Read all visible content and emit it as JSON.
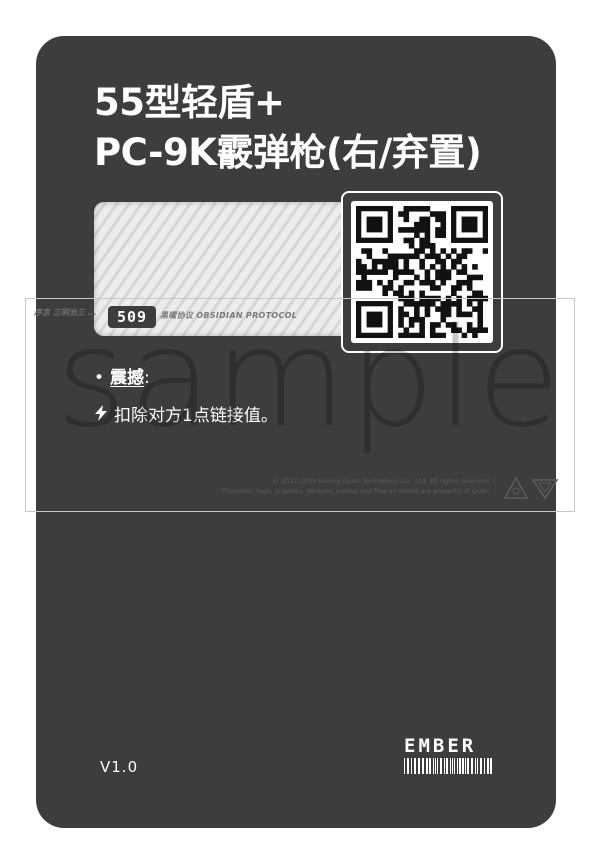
{
  "card": {
    "title_line1": "55型轻盾+",
    "title_line2": "PC-9K霰弹枪(右/弃置)",
    "card_id": "509",
    "art_caption": "黑曜协议 OBSIDIAN PROTOCOL",
    "effect_keyword": "震撼",
    "effect_colon": ":",
    "effect_text": "扣除对方1点链接值。",
    "copyright_line1": "© 2017-2018 Beijing Quan Technology Co., Ltd. All rights reserved",
    "copyright_line2": "Character, logo, graphics, designs, names and fine on model are property of Quan",
    "version": "V1.0",
    "brand_logo": "EMBER"
  },
  "watermark": {
    "text": "sample",
    "strip_text": "序言 三明治三 ..."
  },
  "colors": {
    "card_bg": "#3d3d3d",
    "text": "#ffffff",
    "watermark": "#000000"
  },
  "icons": {
    "bullet": "bullet-dot",
    "bolt": "lightning-bolt-icon",
    "qr": "qr-code",
    "rating": "rating-mark-icons",
    "barcode": "barcode"
  }
}
